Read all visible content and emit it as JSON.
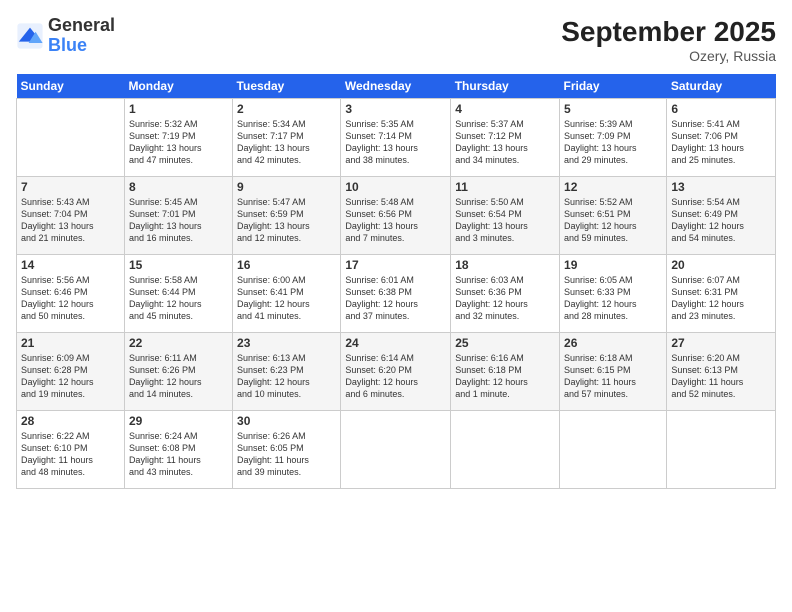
{
  "header": {
    "logo_general": "General",
    "logo_blue": "Blue",
    "month": "September 2025",
    "location": "Ozery, Russia"
  },
  "days_of_week": [
    "Sunday",
    "Monday",
    "Tuesday",
    "Wednesday",
    "Thursday",
    "Friday",
    "Saturday"
  ],
  "weeks": [
    [
      {
        "day": "",
        "info": ""
      },
      {
        "day": "1",
        "info": "Sunrise: 5:32 AM\nSunset: 7:19 PM\nDaylight: 13 hours\nand 47 minutes."
      },
      {
        "day": "2",
        "info": "Sunrise: 5:34 AM\nSunset: 7:17 PM\nDaylight: 13 hours\nand 42 minutes."
      },
      {
        "day": "3",
        "info": "Sunrise: 5:35 AM\nSunset: 7:14 PM\nDaylight: 13 hours\nand 38 minutes."
      },
      {
        "day": "4",
        "info": "Sunrise: 5:37 AM\nSunset: 7:12 PM\nDaylight: 13 hours\nand 34 minutes."
      },
      {
        "day": "5",
        "info": "Sunrise: 5:39 AM\nSunset: 7:09 PM\nDaylight: 13 hours\nand 29 minutes."
      },
      {
        "day": "6",
        "info": "Sunrise: 5:41 AM\nSunset: 7:06 PM\nDaylight: 13 hours\nand 25 minutes."
      }
    ],
    [
      {
        "day": "7",
        "info": "Sunrise: 5:43 AM\nSunset: 7:04 PM\nDaylight: 13 hours\nand 21 minutes."
      },
      {
        "day": "8",
        "info": "Sunrise: 5:45 AM\nSunset: 7:01 PM\nDaylight: 13 hours\nand 16 minutes."
      },
      {
        "day": "9",
        "info": "Sunrise: 5:47 AM\nSunset: 6:59 PM\nDaylight: 13 hours\nand 12 minutes."
      },
      {
        "day": "10",
        "info": "Sunrise: 5:48 AM\nSunset: 6:56 PM\nDaylight: 13 hours\nand 7 minutes."
      },
      {
        "day": "11",
        "info": "Sunrise: 5:50 AM\nSunset: 6:54 PM\nDaylight: 13 hours\nand 3 minutes."
      },
      {
        "day": "12",
        "info": "Sunrise: 5:52 AM\nSunset: 6:51 PM\nDaylight: 12 hours\nand 59 minutes."
      },
      {
        "day": "13",
        "info": "Sunrise: 5:54 AM\nSunset: 6:49 PM\nDaylight: 12 hours\nand 54 minutes."
      }
    ],
    [
      {
        "day": "14",
        "info": "Sunrise: 5:56 AM\nSunset: 6:46 PM\nDaylight: 12 hours\nand 50 minutes."
      },
      {
        "day": "15",
        "info": "Sunrise: 5:58 AM\nSunset: 6:44 PM\nDaylight: 12 hours\nand 45 minutes."
      },
      {
        "day": "16",
        "info": "Sunrise: 6:00 AM\nSunset: 6:41 PM\nDaylight: 12 hours\nand 41 minutes."
      },
      {
        "day": "17",
        "info": "Sunrise: 6:01 AM\nSunset: 6:38 PM\nDaylight: 12 hours\nand 37 minutes."
      },
      {
        "day": "18",
        "info": "Sunrise: 6:03 AM\nSunset: 6:36 PM\nDaylight: 12 hours\nand 32 minutes."
      },
      {
        "day": "19",
        "info": "Sunrise: 6:05 AM\nSunset: 6:33 PM\nDaylight: 12 hours\nand 28 minutes."
      },
      {
        "day": "20",
        "info": "Sunrise: 6:07 AM\nSunset: 6:31 PM\nDaylight: 12 hours\nand 23 minutes."
      }
    ],
    [
      {
        "day": "21",
        "info": "Sunrise: 6:09 AM\nSunset: 6:28 PM\nDaylight: 12 hours\nand 19 minutes."
      },
      {
        "day": "22",
        "info": "Sunrise: 6:11 AM\nSunset: 6:26 PM\nDaylight: 12 hours\nand 14 minutes."
      },
      {
        "day": "23",
        "info": "Sunrise: 6:13 AM\nSunset: 6:23 PM\nDaylight: 12 hours\nand 10 minutes."
      },
      {
        "day": "24",
        "info": "Sunrise: 6:14 AM\nSunset: 6:20 PM\nDaylight: 12 hours\nand 6 minutes."
      },
      {
        "day": "25",
        "info": "Sunrise: 6:16 AM\nSunset: 6:18 PM\nDaylight: 12 hours\nand 1 minute."
      },
      {
        "day": "26",
        "info": "Sunrise: 6:18 AM\nSunset: 6:15 PM\nDaylight: 11 hours\nand 57 minutes."
      },
      {
        "day": "27",
        "info": "Sunrise: 6:20 AM\nSunset: 6:13 PM\nDaylight: 11 hours\nand 52 minutes."
      }
    ],
    [
      {
        "day": "28",
        "info": "Sunrise: 6:22 AM\nSunset: 6:10 PM\nDaylight: 11 hours\nand 48 minutes."
      },
      {
        "day": "29",
        "info": "Sunrise: 6:24 AM\nSunset: 6:08 PM\nDaylight: 11 hours\nand 43 minutes."
      },
      {
        "day": "30",
        "info": "Sunrise: 6:26 AM\nSunset: 6:05 PM\nDaylight: 11 hours\nand 39 minutes."
      },
      {
        "day": "",
        "info": ""
      },
      {
        "day": "",
        "info": ""
      },
      {
        "day": "",
        "info": ""
      },
      {
        "day": "",
        "info": ""
      }
    ]
  ]
}
